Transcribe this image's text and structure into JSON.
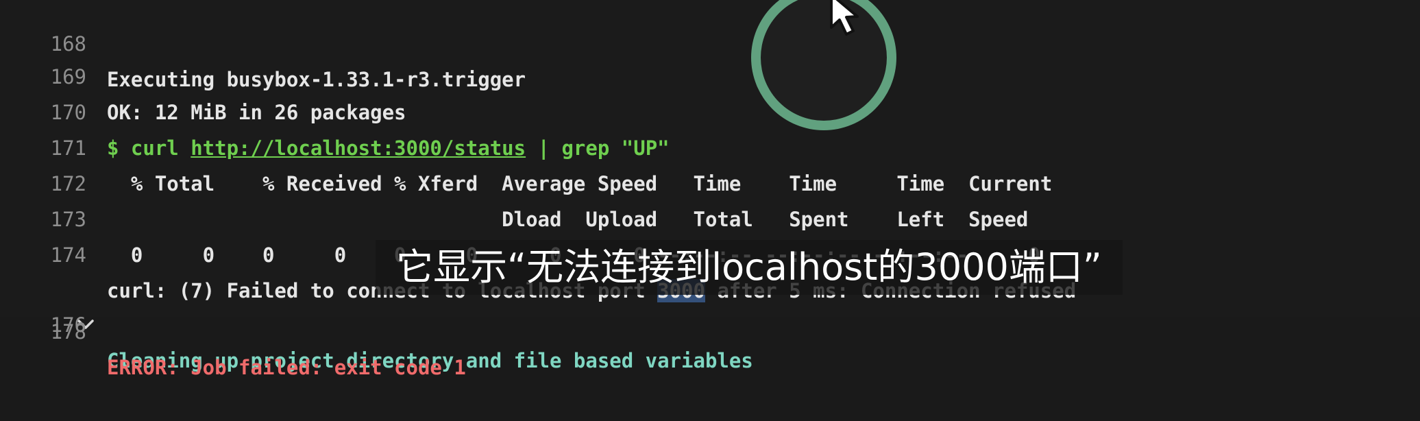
{
  "terminal": {
    "lines": [
      {
        "num": "168",
        "text": "Executing busybox-1.33.1-r3.trigger"
      },
      {
        "num": "169",
        "text": "OK: 12 MiB in 26 packages"
      },
      {
        "num": "170",
        "prompt": "$ curl ",
        "link": "http://localhost:3000/status",
        "rest": " | grep \"UP\""
      },
      {
        "num": "171",
        "text": "  % Total    % Received % Xferd  Average Speed   Time    Time     Time  Current"
      },
      {
        "num": "172",
        "text": "                                 Dload  Upload   Total   Spent    Left  Speed"
      },
      {
        "num": "173",
        "text": "  0     0    0     0    0     0      0      0 --:--:-- --:--:-- --:--:--     0"
      },
      {
        "num": "174",
        "pre": "curl: (7) Failed to connect to localhost port ",
        "hl": "3000",
        "post": " after 5 ms: Connection refused"
      },
      {
        "num": "176",
        "text": "Cleaning up project directory and file based variables"
      },
      {
        "num": "178",
        "text": "ERROR: Job failed: exit code 1"
      }
    ]
  },
  "subtitle": "它显示“无法连接到localhost的3000端口”",
  "colors": {
    "prompt": "#6fcf4f",
    "section": "#7fd6c2",
    "error": "#f06b6b",
    "highlight": "#34507a"
  },
  "icons": {
    "collapse": "chevron-down-icon",
    "cursor": "mouse-pointer-icon"
  }
}
